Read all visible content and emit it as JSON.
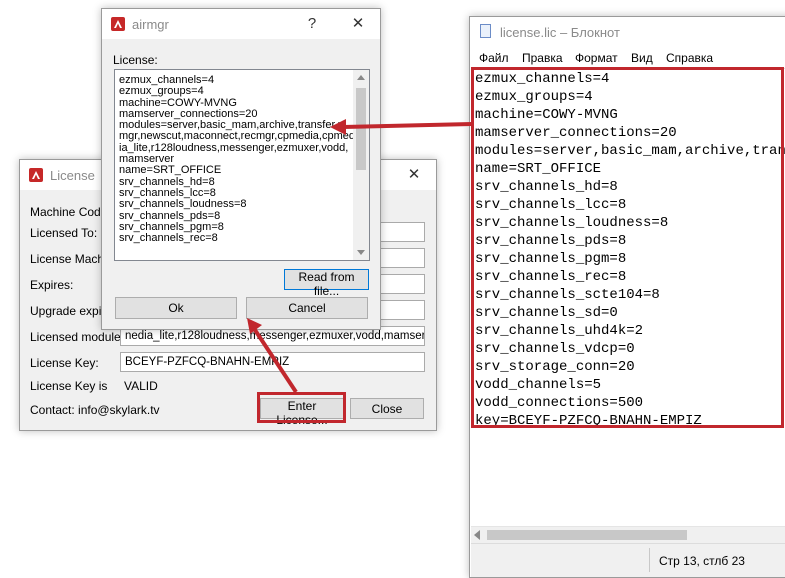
{
  "license_dialog": {
    "title": "License",
    "close_glyph": "✕",
    "rows": [
      {
        "label": "Machine Code:",
        "value": ""
      },
      {
        "label": "Licensed To:",
        "value": ""
      },
      {
        "label": "License Machin",
        "value": ""
      },
      {
        "label": "Expires:",
        "value": ""
      },
      {
        "label": "Upgrade expire",
        "value": ""
      },
      {
        "label": "Licensed modules:",
        "value": "nedia_lite,r128loudness,messenger,ezmuxer,vodd,mamserver"
      },
      {
        "label": "License Key:",
        "value": "BCEYF-PZFCQ-BNAHN-EMPIZ"
      }
    ],
    "status_label": "License Key is",
    "status_value": "VALID",
    "contact": "Contact: info@skylark.tv",
    "enter_button": "Enter License...",
    "close_button": "Close"
  },
  "airmgr_dialog": {
    "title": "airmgr",
    "help_glyph": "?",
    "close_glyph": "✕",
    "license_label": "License:",
    "lines": [
      "ezmux_channels=4",
      "ezmux_groups=4",
      "machine=COWY-MVNG",
      "mamserver_connections=20",
      "modules=server,basic_mam,archive,transfer,r",
      "mgr,newscut,maconnect,recmgr,cpmedia,cpmed",
      "ia_lite,r128loudness,messenger,ezmuxer,vodd,",
      "mamserver",
      "name=SRT_OFFICE",
      "srv_channels_hd=8",
      "srv_channels_lcc=8",
      "srv_channels_loudness=8",
      "srv_channels_pds=8",
      "srv_channels_pgm=8",
      "srv_channels_rec=8"
    ],
    "read_button": "Read from file...",
    "ok_button": "Ok",
    "cancel_button": "Cancel"
  },
  "notepad": {
    "title": "license.lic – Блокнот",
    "menu": [
      "Файл",
      "Правка",
      "Формат",
      "Вид",
      "Справка"
    ],
    "lines": [
      "ezmux_channels=4",
      "ezmux_groups=4",
      "machine=COWY-MVNG",
      "mamserver_connections=20",
      "modules=server,basic_mam,archive,transf",
      "name=SRT_OFFICE",
      "srv_channels_hd=8",
      "srv_channels_lcc=8",
      "srv_channels_loudness=8",
      "srv_channels_pds=8",
      "srv_channels_pgm=8",
      "srv_channels_rec=8",
      "srv_channels_scte104=8",
      "srv_channels_sd=0",
      "srv_channels_uhd4k=2",
      "srv_channels_vdcp=0",
      "srv_storage_conn=20",
      "vodd_channels=5",
      "vodd_connections=500",
      "key=BCEYF-PZFCQ-BNAHN-EMPIZ"
    ],
    "status": "Стр 13, стлб 23"
  },
  "colors": {
    "highlight": "#c1272d",
    "focus": "#0078d7"
  }
}
